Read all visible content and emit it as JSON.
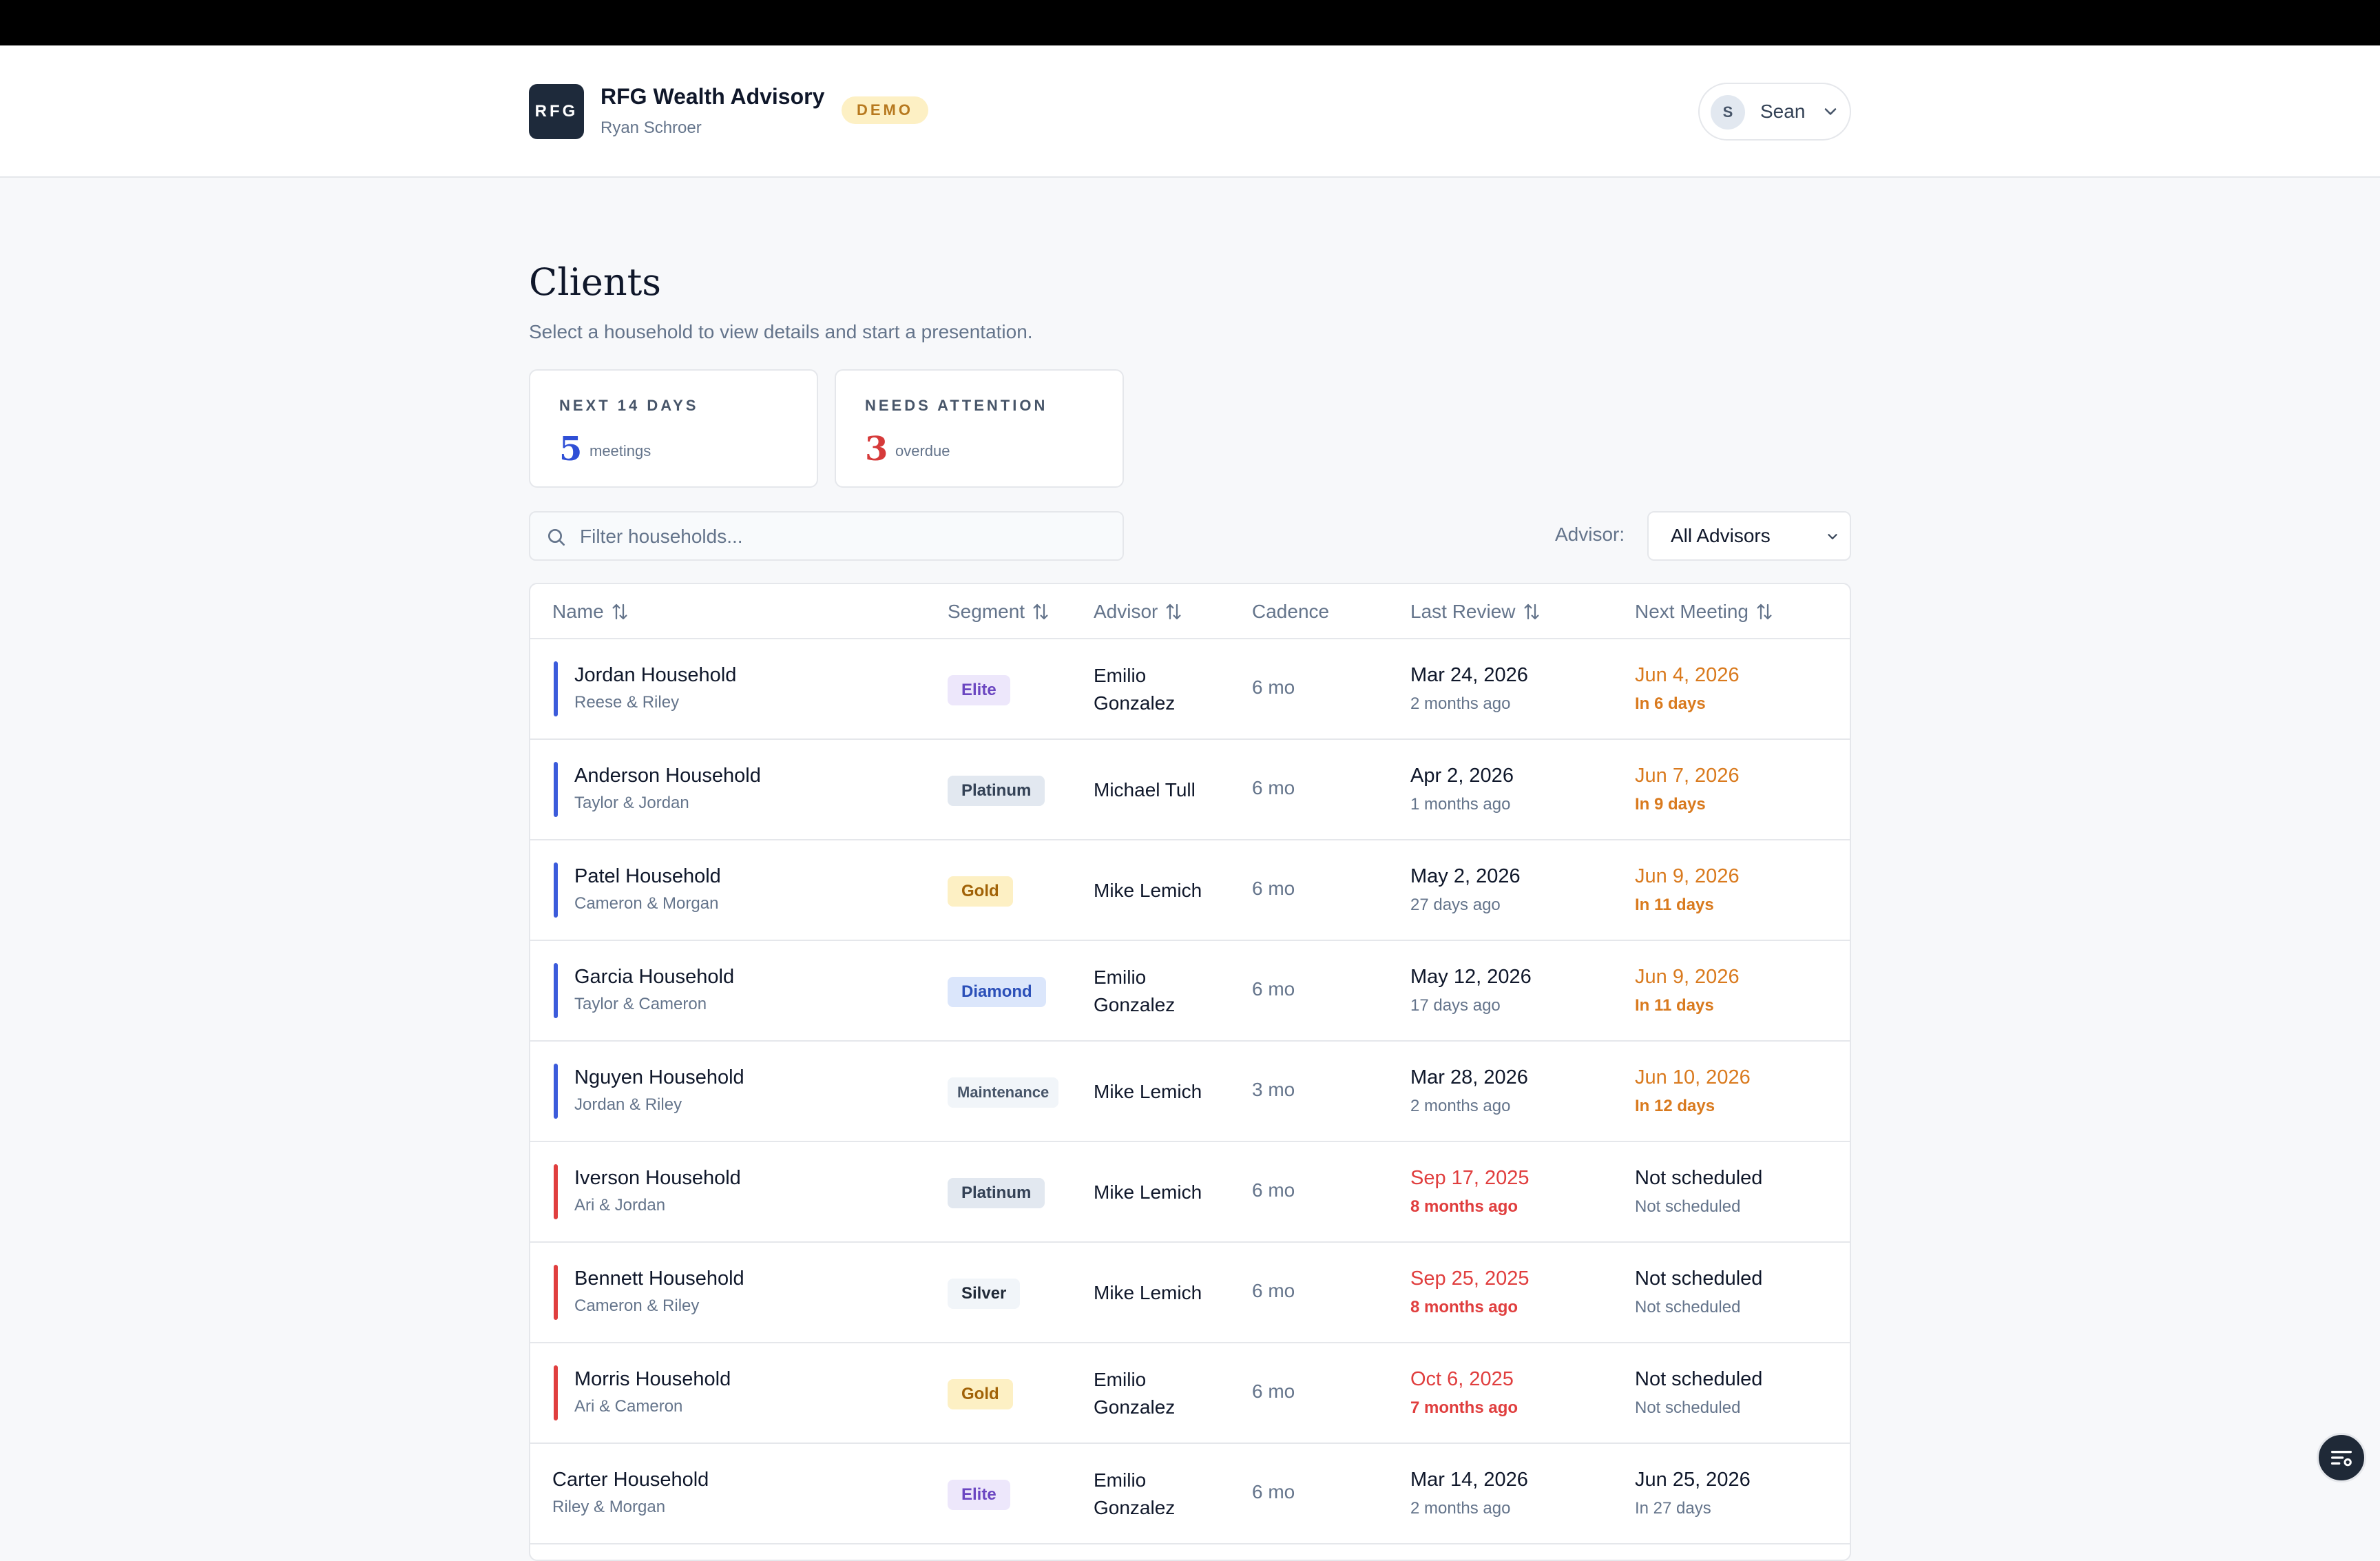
{
  "app": {
    "logo_text": "RFG",
    "name": "RFG Wealth Advisory",
    "subtitle": "Ryan Schroer",
    "env_badge": "DEMO",
    "user": {
      "initial": "S",
      "name": "Sean"
    }
  },
  "page": {
    "title": "Clients",
    "subtitle": "Select a household to view details and start a presentation."
  },
  "stats": [
    {
      "label": "NEXT 14 DAYS",
      "value": "5",
      "unit": "meetings",
      "color": "#2f4fd6"
    },
    {
      "label": "NEEDS ATTENTION",
      "value": "3",
      "unit": "overdue",
      "color": "#d63a3a"
    }
  ],
  "filter": {
    "placeholder": "Filter households...",
    "value": ""
  },
  "advisor_filter": {
    "label": "Advisor:",
    "selected": "All Advisors"
  },
  "table": {
    "columns": [
      "Name",
      "Segment",
      "Advisor",
      "Cadence",
      "Last Review",
      "Next Meeting"
    ],
    "rows": [
      {
        "name": "Jordan Household",
        "members": "Reese & Riley",
        "segment": "Elite",
        "advisor": "Emilio Gonzalez",
        "cadence": "6 mo",
        "last_review": "Mar 24, 2026",
        "last_review_rel": "2 months ago",
        "next_meeting": "Jun 4, 2026",
        "next_meeting_rel": "In 6 days",
        "status": "upcoming"
      },
      {
        "name": "Anderson Household",
        "members": "Taylor & Jordan",
        "segment": "Platinum",
        "advisor": "Michael Tull",
        "cadence": "6 mo",
        "last_review": "Apr 2, 2026",
        "last_review_rel": "1 months ago",
        "next_meeting": "Jun 7, 2026",
        "next_meeting_rel": "In 9 days",
        "status": "upcoming"
      },
      {
        "name": "Patel Household",
        "members": "Cameron & Morgan",
        "segment": "Gold",
        "advisor": "Mike Lemich",
        "cadence": "6 mo",
        "last_review": "May 2, 2026",
        "last_review_rel": "27 days ago",
        "next_meeting": "Jun 9, 2026",
        "next_meeting_rel": "In 11 days",
        "status": "upcoming"
      },
      {
        "name": "Garcia Household",
        "members": "Taylor & Cameron",
        "segment": "Diamond",
        "advisor": "Emilio Gonzalez",
        "cadence": "6 mo",
        "last_review": "May 12, 2026",
        "last_review_rel": "17 days ago",
        "next_meeting": "Jun 9, 2026",
        "next_meeting_rel": "In 11 days",
        "status": "upcoming"
      },
      {
        "name": "Nguyen Household",
        "members": "Jordan & Riley",
        "segment": "Maintenance",
        "advisor": "Mike Lemich",
        "cadence": "3 mo",
        "last_review": "Mar 28, 2026",
        "last_review_rel": "2 months ago",
        "next_meeting": "Jun 10, 2026",
        "next_meeting_rel": "In 12 days",
        "status": "upcoming"
      },
      {
        "name": "Iverson Household",
        "members": "Ari & Jordan",
        "segment": "Platinum",
        "advisor": "Mike Lemich",
        "cadence": "6 mo",
        "last_review": "Sep 17, 2025",
        "last_review_rel": "8 months ago",
        "next_meeting": "Not scheduled",
        "next_meeting_rel": "Not scheduled",
        "status": "overdue"
      },
      {
        "name": "Bennett Household",
        "members": "Cameron & Riley",
        "segment": "Silver",
        "advisor": "Mike Lemich",
        "cadence": "6 mo",
        "last_review": "Sep 25, 2025",
        "last_review_rel": "8 months ago",
        "next_meeting": "Not scheduled",
        "next_meeting_rel": "Not scheduled",
        "status": "overdue"
      },
      {
        "name": "Morris Household",
        "members": "Ari & Cameron",
        "segment": "Gold",
        "advisor": "Emilio Gonzalez",
        "cadence": "6 mo",
        "last_review": "Oct 6, 2025",
        "last_review_rel": "7 months ago",
        "next_meeting": "Not scheduled",
        "next_meeting_rel": "Not scheduled",
        "status": "overdue"
      },
      {
        "name": "Carter Household",
        "members": "Riley & Morgan",
        "segment": "Elite",
        "advisor": "Emilio Gonzalez",
        "cadence": "6 mo",
        "last_review": "Mar 14, 2026",
        "last_review_rel": "2 months ago",
        "next_meeting": "Jun 25, 2026",
        "next_meeting_rel": "In 27 days",
        "status": "normal"
      }
    ]
  },
  "colors": {
    "upcoming_accent": "#3b5bdb",
    "overdue_accent": "#e03e3e",
    "upcoming_text": "#d97a1e",
    "overdue_text": "#e03e3e",
    "segments": {
      "Elite": {
        "bg": "#ede7fb",
        "fg": "#6b46c1"
      },
      "Platinum": {
        "bg": "#e2e8f0",
        "fg": "#334155"
      },
      "Gold": {
        "bg": "#fdf0c4",
        "fg": "#a16207"
      },
      "Diamond": {
        "bg": "#dbe6fb",
        "fg": "#2b4fb8"
      },
      "Maintenance": {
        "bg": "#f1f5f9",
        "fg": "#475569"
      },
      "Silver": {
        "bg": "#f1f5f9",
        "fg": "#1f2937"
      }
    }
  },
  "icons": {
    "search": "search-icon",
    "sort": "sort-icon",
    "chevron": "chevron-down-icon",
    "fab": "list-filter-icon"
  }
}
